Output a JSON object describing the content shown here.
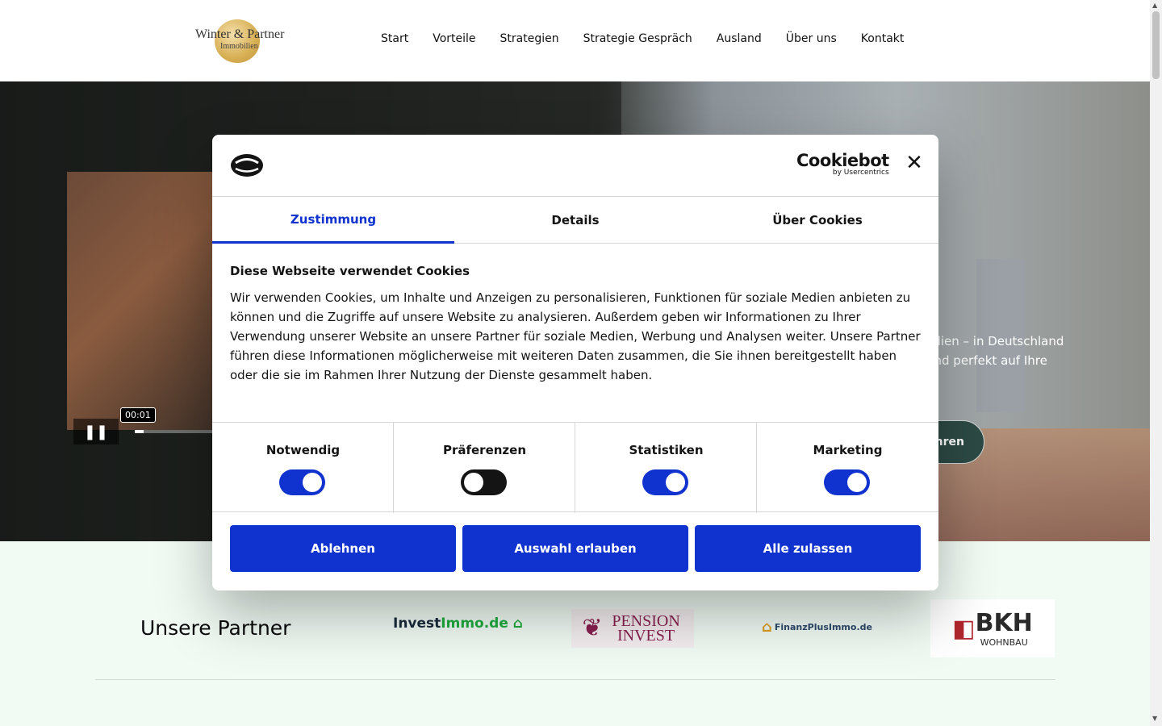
{
  "header": {
    "logo_name": "Winter & Partner",
    "logo_sub": "Immobilien",
    "nav": [
      "Start",
      "Vorteile",
      "Strategien",
      "Strategie Gespräch",
      "Ausland",
      "Über uns",
      "Kontakt"
    ]
  },
  "hero": {
    "text_line1": "bilien – in Deutschland",
    "text_line2": "und perfekt auf Ihre",
    "button_label": "hren",
    "video_time": "00:01",
    "video_progress": 0.1
  },
  "partners": {
    "heading": "Unsere Partner",
    "logo1_a": "Invest",
    "logo1_b": "Immo.de",
    "logo2": "PENSION INVEST",
    "logo3": "FinanzPlusImmo.de",
    "logo4_a": "B",
    "logo4_b": "KH",
    "logo4_sub": "WOHNBAU"
  },
  "dialog": {
    "brand": "Cookiebot",
    "brand_sub": "by Usercentrics",
    "tabs": [
      "Zustimmung",
      "Details",
      "Über Cookies"
    ],
    "title": "Diese Webseite verwendet Cookies",
    "text": "Wir verwenden Cookies, um Inhalte und Anzeigen zu personalisieren, Funktionen für soziale Medien anbieten zu können und die Zugriffe auf unsere Website zu analysieren. Außerdem geben wir Informationen zu Ihrer Verwendung unserer Website an unsere Partner für soziale Medien, Werbung und Analysen weiter. Unsere Partner führen diese Informationen möglicherweise mit weiteren Daten zusammen, die Sie ihnen bereitgestellt haben oder die sie im Rahmen Ihrer Nutzung der Dienste gesammelt haben.",
    "categories": [
      {
        "label": "Notwendig",
        "checked": true
      },
      {
        "label": "Präferenzen",
        "checked": false
      },
      {
        "label": "Statistiken",
        "checked": true
      },
      {
        "label": "Marketing",
        "checked": true
      }
    ],
    "buttons": {
      "decline": "Ablehnen",
      "allow_selection": "Auswahl erlauben",
      "allow_all": "Alle zulassen"
    }
  },
  "colors": {
    "accent": "#1032cf",
    "toggle_off": "#141414"
  }
}
